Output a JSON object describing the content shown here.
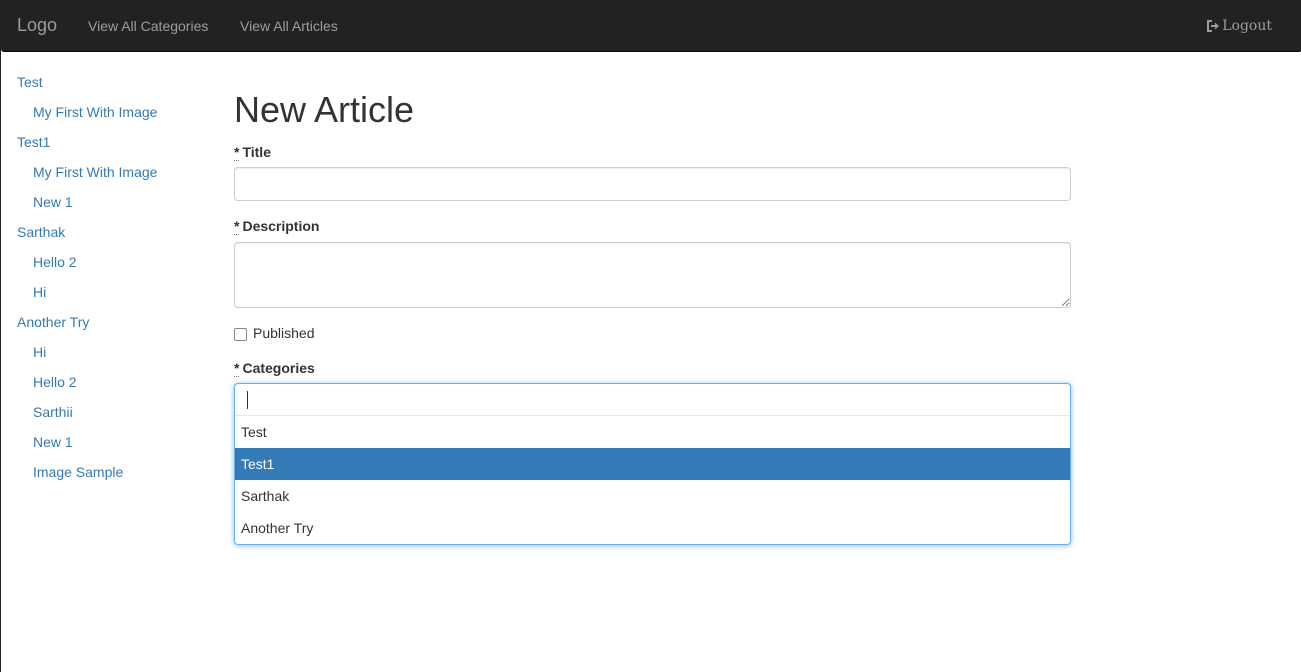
{
  "navbar": {
    "brand": "Logo",
    "links": [
      {
        "label": "View All Categories"
      },
      {
        "label": "View All Articles"
      }
    ],
    "logout_label": "Logout"
  },
  "sidebar": {
    "items": [
      {
        "label": "Test",
        "level": 0
      },
      {
        "label": "My First With Image",
        "level": 1
      },
      {
        "label": "Test1",
        "level": 0
      },
      {
        "label": "My First With Image",
        "level": 1
      },
      {
        "label": "New 1",
        "level": 1
      },
      {
        "label": "Sarthak",
        "level": 0
      },
      {
        "label": "Hello 2",
        "level": 1
      },
      {
        "label": "Hi",
        "level": 1
      },
      {
        "label": "Another Try",
        "level": 0
      },
      {
        "label": "Hi",
        "level": 1
      },
      {
        "label": "Hello 2",
        "level": 1
      },
      {
        "label": "Sarthii",
        "level": 1
      },
      {
        "label": "New 1",
        "level": 1
      },
      {
        "label": "Image Sample",
        "level": 1
      }
    ]
  },
  "form": {
    "page_title": "New Article",
    "required_mark": "*",
    "title_label": "Title",
    "title_value": "",
    "description_label": "Description",
    "description_value": "",
    "published_label": "Published",
    "published_checked": false,
    "categories_label": "Categories",
    "categories_search": "",
    "categories_options": [
      {
        "label": "Test",
        "highlighted": false
      },
      {
        "label": "Test1",
        "highlighted": true
      },
      {
        "label": "Sarthak",
        "highlighted": false
      },
      {
        "label": "Another Try",
        "highlighted": false
      }
    ]
  },
  "colors": {
    "navbar_bg": "#222222",
    "link": "#337ab7",
    "highlight": "#337ab7",
    "focus_border": "#66afe9"
  },
  "icons": {
    "logout": "logout-icon"
  }
}
